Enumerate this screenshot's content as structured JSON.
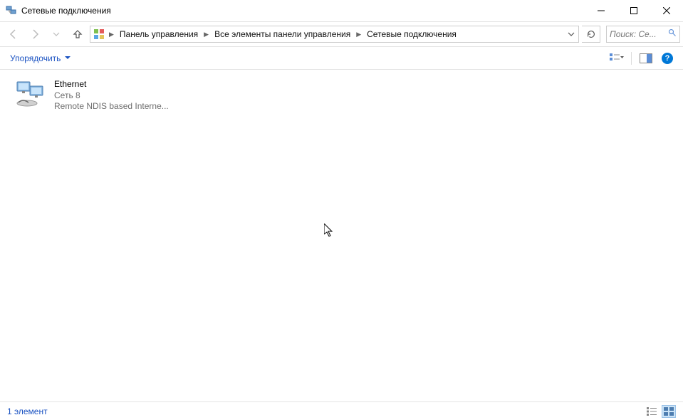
{
  "title": "Сетевые подключения",
  "breadcrumb": {
    "items": [
      "Панель управления",
      "Все элементы панели управления",
      "Сетевые подключения"
    ]
  },
  "search": {
    "placeholder": "Поиск: Се..."
  },
  "toolbar": {
    "organize": "Упорядочить"
  },
  "connections": [
    {
      "name": "Ethernet",
      "network": "Сеть 8",
      "device": "Remote NDIS based Interne..."
    }
  ],
  "status": {
    "count_label": "1 элемент"
  }
}
